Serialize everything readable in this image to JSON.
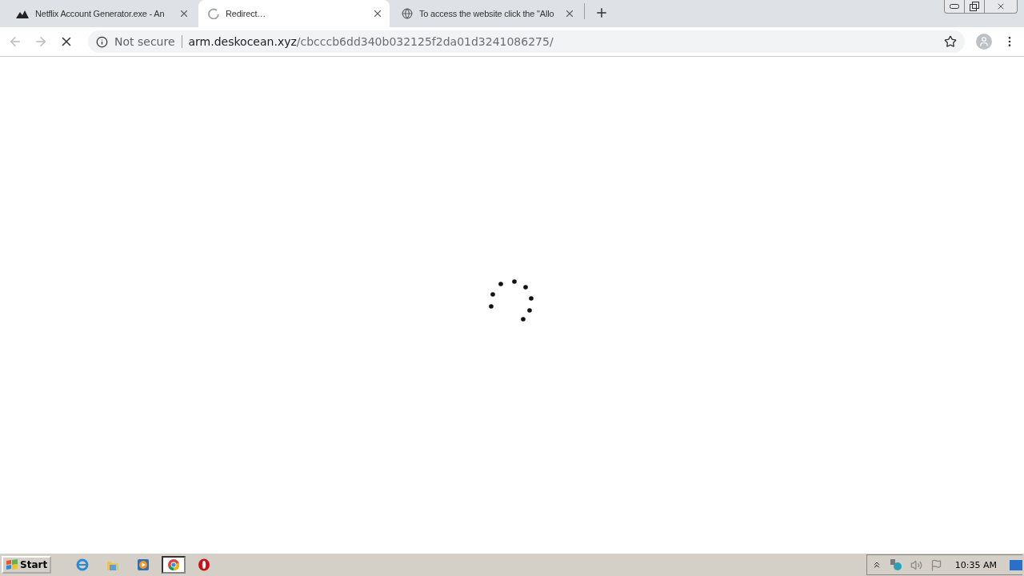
{
  "tabs": [
    {
      "title": "Netflix Account Generator.exe - An",
      "selected": false,
      "kind": "logo"
    },
    {
      "title": "Redirect…",
      "selected": true,
      "kind": "loading"
    },
    {
      "title": "To access the website click the \"Allo",
      "selected": false,
      "kind": "globe"
    }
  ],
  "address_bar": {
    "security": "Not secure",
    "host": "arm.deskocean.xyz",
    "path": "/cbcccb6dd340b032125f2da01d3241086275/"
  },
  "page": {
    "loading": true
  },
  "taskbar": {
    "start": "Start",
    "apps": [
      {
        "kind": "ie",
        "selected": false
      },
      {
        "kind": "folder",
        "selected": false
      },
      {
        "kind": "media",
        "selected": false
      },
      {
        "kind": "chrome",
        "selected": true
      },
      {
        "kind": "opera",
        "selected": false
      }
    ],
    "clock": "10:35 AM"
  }
}
